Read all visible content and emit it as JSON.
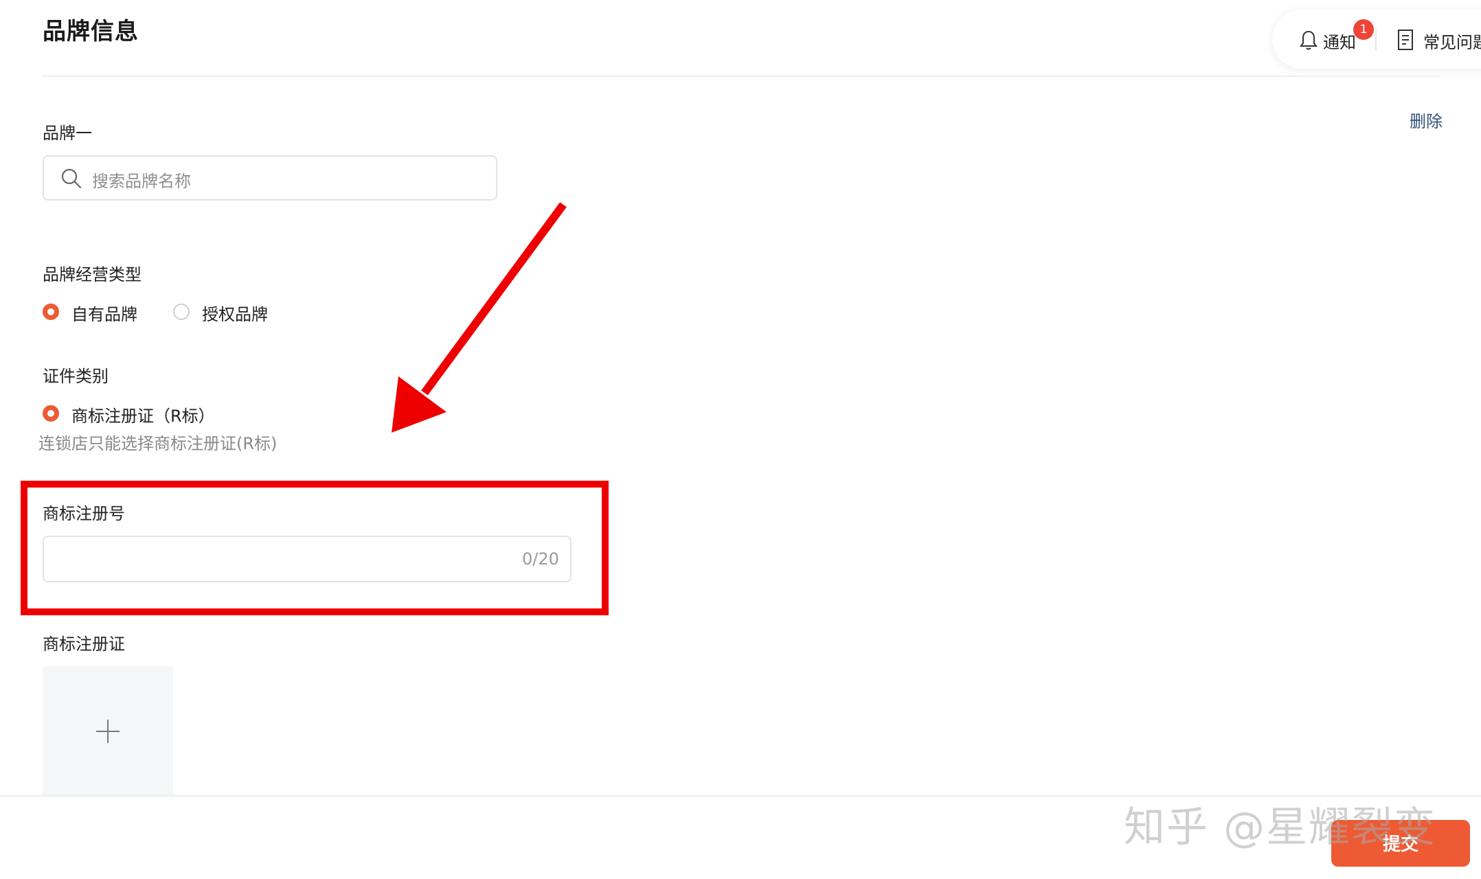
{
  "header": {
    "title": "品牌信息",
    "notify_label": "通知",
    "notify_badge": "1",
    "faq_label": "常见问题"
  },
  "brand": {
    "section_label": "品牌一",
    "delete_label": "删除",
    "search_placeholder": "搜索品牌名称"
  },
  "operation_type": {
    "label": "品牌经营类型",
    "options": [
      {
        "label": "自有品牌",
        "selected": true
      },
      {
        "label": "授权品牌",
        "selected": false
      }
    ]
  },
  "certificate": {
    "label": "证件类别",
    "option": "商标注册证（R标）",
    "hint": "连锁店只能选择商标注册证(R标)"
  },
  "trademark_number": {
    "label": "商标注册号",
    "value": "",
    "counter": "0/20"
  },
  "trademark_certificate": {
    "label": "商标注册证"
  },
  "footer": {
    "submit_label": "提交",
    "watermark": "知乎 @星耀裂变"
  },
  "colors": {
    "accent": "#ee5a33",
    "annotation_red": "#ee0000",
    "link": "#2f4f7a",
    "badge": "#f04438"
  }
}
